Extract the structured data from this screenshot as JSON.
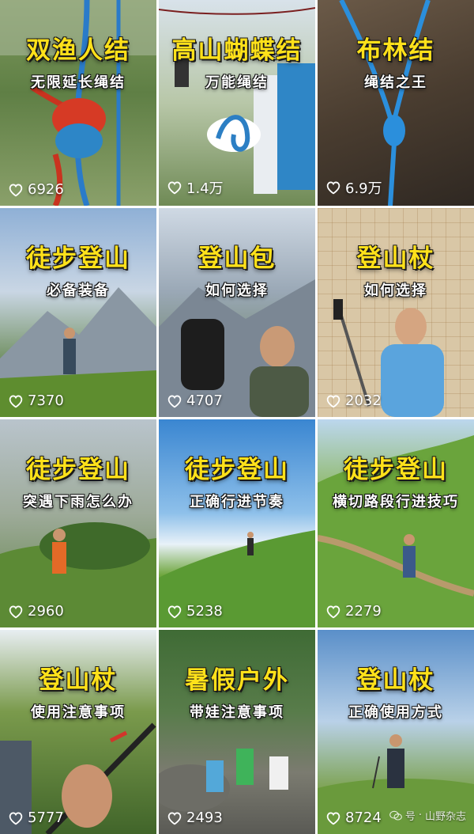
{
  "cards": [
    {
      "title": "双渔人结",
      "subtitle": "无限延长绳结",
      "likes": "6926"
    },
    {
      "title": "高山蝴蝶结",
      "subtitle": "万能绳结",
      "likes": "1.4万"
    },
    {
      "title": "布林结",
      "subtitle": "绳结之王",
      "likes": "6.9万"
    },
    {
      "title": "徒步登山",
      "subtitle": "必备装备",
      "likes": "7370"
    },
    {
      "title": "登山包",
      "subtitle": "如何选择",
      "likes": "4707"
    },
    {
      "title": "登山杖",
      "subtitle": "如何选择",
      "likes": "2032"
    },
    {
      "title": "徒步登山",
      "subtitle": "突遇下雨怎么办",
      "likes": "2960"
    },
    {
      "title": "徒步登山",
      "subtitle": "正确行进节奏",
      "likes": "5238"
    },
    {
      "title": "徒步登山",
      "subtitle": "横切路段行进技巧",
      "likes": "2279"
    },
    {
      "title": "登山杖",
      "subtitle": "使用注意事项",
      "likes": "5777"
    },
    {
      "title": "暑假户外",
      "subtitle": "带娃注意事项",
      "likes": "2493"
    },
    {
      "title": "登山杖",
      "subtitle": "正确使用方式",
      "likes": "8724"
    }
  ],
  "watermark": {
    "prefix": "号",
    "name": "山野杂志"
  },
  "icons": {
    "like": "heart-outline-icon",
    "watermark": "wechat-icon"
  },
  "colors": {
    "title": "#ffe11a",
    "subtitle": "#ffffff",
    "likes": "#ffffff"
  }
}
